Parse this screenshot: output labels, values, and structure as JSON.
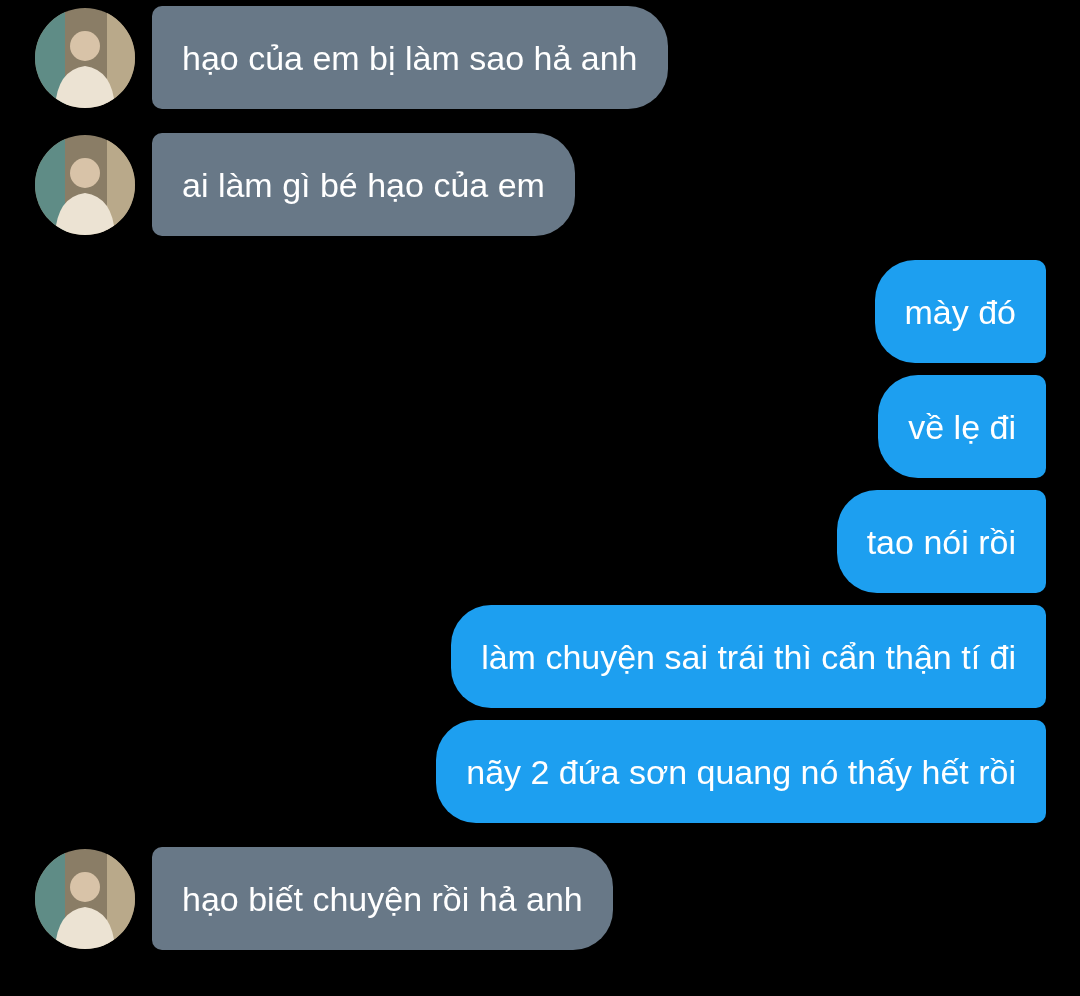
{
  "messages": [
    {
      "kind": "incoming",
      "text": "hạo của em bị làm sao hả anh"
    },
    {
      "kind": "incoming",
      "text": "ai làm gì bé hạo của em"
    },
    {
      "kind": "outgoing",
      "text": "mày đó"
    },
    {
      "kind": "outgoing",
      "text": "về lẹ đi"
    },
    {
      "kind": "outgoing",
      "text": "tao nói rồi"
    },
    {
      "kind": "outgoing",
      "text": "làm chuyện sai trái thì cẩn thận tí đi"
    },
    {
      "kind": "outgoing",
      "text": "nãy 2 đứa sơn quang nó thấy hết rồi"
    },
    {
      "kind": "incoming",
      "text": "hạo biết chuyện rồi hả anh"
    }
  ]
}
